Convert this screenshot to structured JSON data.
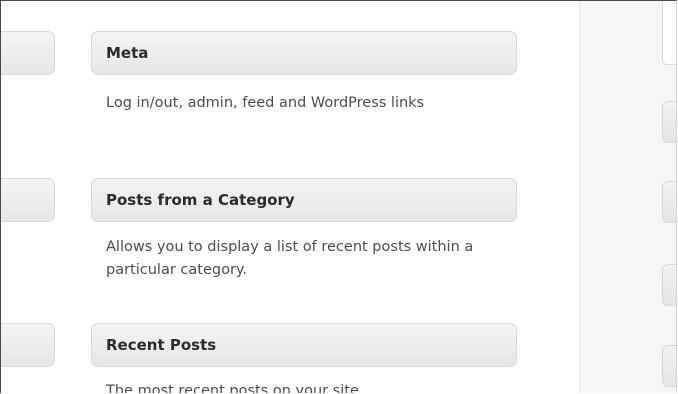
{
  "widgets": [
    {
      "title": "Meta",
      "description": "Log in/out, admin, feed and WordPress links"
    },
    {
      "title": "Posts from a Category",
      "description": "Allows you to display a list of recent posts within a particular category."
    },
    {
      "title": "Recent Posts",
      "description": "The most recent posts on your site"
    }
  ]
}
